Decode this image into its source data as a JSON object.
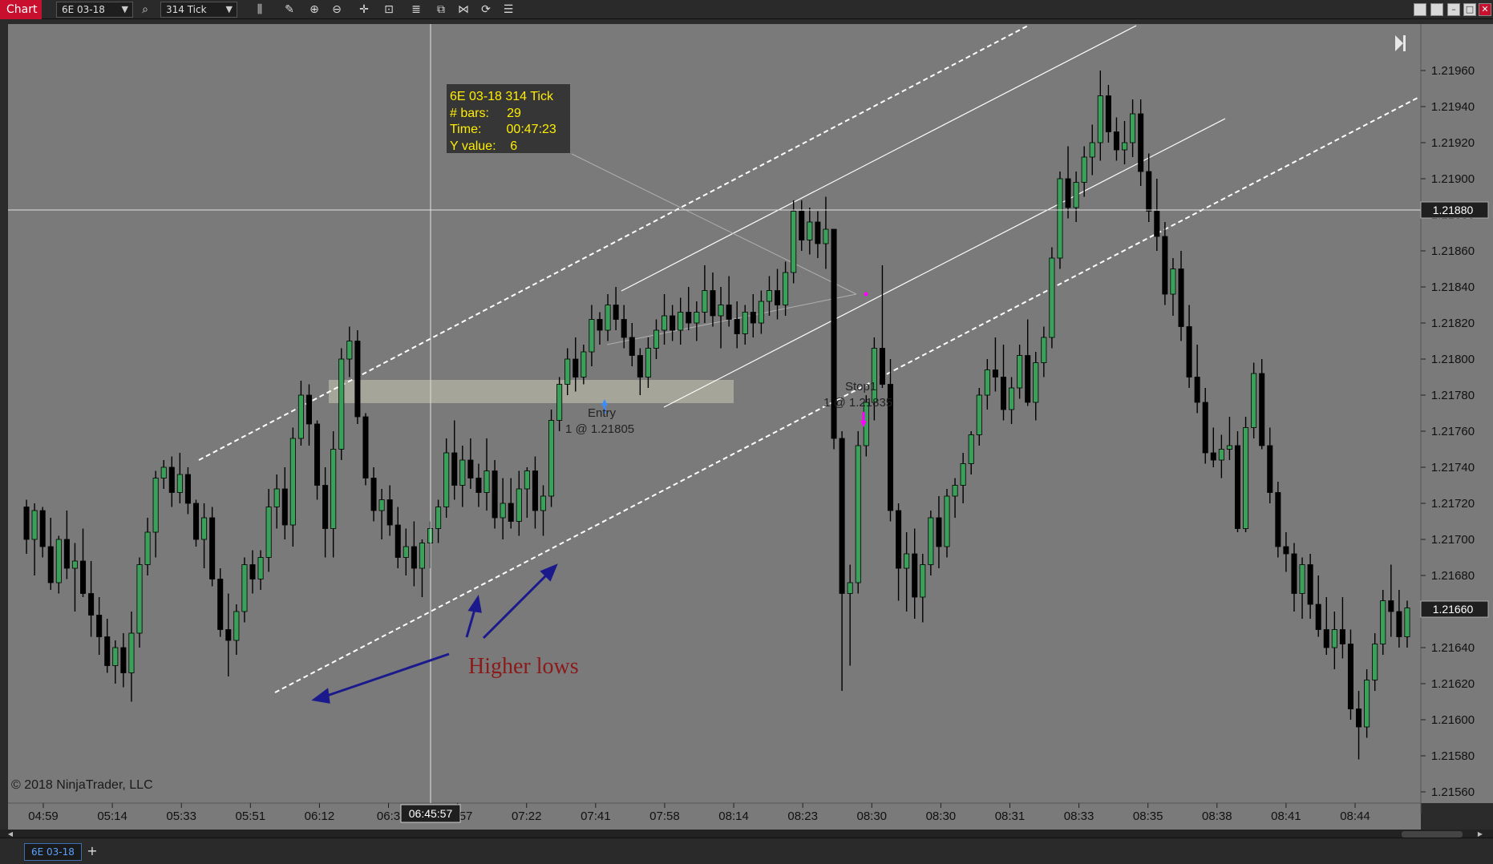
{
  "toolbar": {
    "chart_label": "Chart",
    "instrument": "6E 03-18",
    "interval": "314 Tick"
  },
  "tab": {
    "label": "6E 03-18",
    "add": "+"
  },
  "copyright": "© 2018 NinjaTrader, LLC",
  "data_box": {
    "line1": "6E 03-18 314 Tick",
    "line2": "# bars:     29",
    "line3": "Time:       00:47:23",
    "line4": "Y value:    6"
  },
  "annotation": {
    "text": "Higher lows"
  },
  "orders": {
    "entry_label": "Entry",
    "entry_price": "1 @ 1.21805",
    "stop_label": "Stop1",
    "stop_price": "1 @ 1.21835"
  },
  "crosshair": {
    "time_label": "06:45:57",
    "price_label": "1.21880"
  },
  "last_price_label": "1.21660",
  "colors": {
    "background": "#7a7a7a",
    "bull": "#3aa05a",
    "bear": "#000000",
    "annotation_text": "#8b1a1a",
    "arrows": "#1a1a8c",
    "data_box_text": "#ffee00",
    "zone": "#c8c8b4"
  },
  "chart_data": {
    "type": "candlestick",
    "price_axis_labels": [
      "1.21960",
      "1.21940",
      "1.21920",
      "1.21900",
      "1.21880",
      "1.21860",
      "1.21840",
      "1.21820",
      "1.21800",
      "1.21780",
      "1.21760",
      "1.21740",
      "1.21720",
      "1.21700",
      "1.21680",
      "1.21660",
      "1.21640",
      "1.21620",
      "1.21600",
      "1.21580",
      "1.21560"
    ],
    "ylim": [
      1.2156,
      1.2196
    ],
    "time_axis_labels": [
      "04:59",
      "05:14",
      "05:33",
      "05:51",
      "06:12",
      "06:3",
      "06:57",
      "07:22",
      "07:41",
      "07:58",
      "08:14",
      "08:23",
      "08:30",
      "08:30",
      "08:31",
      "08:33",
      "08:35",
      "08:38",
      "08:41",
      "08:44"
    ],
    "candles": [
      [
        1.21718,
        1.21722,
        1.21692,
        1.217
      ],
      [
        1.217,
        1.2172,
        1.2168,
        1.21716
      ],
      [
        1.21716,
        1.21718,
        1.2169,
        1.21696
      ],
      [
        1.21696,
        1.21712,
        1.21672,
        1.21676
      ],
      [
        1.21676,
        1.21702,
        1.2167,
        1.217
      ],
      [
        1.217,
        1.21716,
        1.21678,
        1.21684
      ],
      [
        1.21684,
        1.21698,
        1.2166,
        1.21688
      ],
      [
        1.21688,
        1.21706,
        1.21668,
        1.2167
      ],
      [
        1.2167,
        1.21688,
        1.21646,
        1.21658
      ],
      [
        1.21658,
        1.21668,
        1.21636,
        1.21646
      ],
      [
        1.21646,
        1.21656,
        1.21626,
        1.2163
      ],
      [
        1.2163,
        1.21644,
        1.2162,
        1.2164
      ],
      [
        1.2164,
        1.21648,
        1.21618,
        1.21626
      ],
      [
        1.21626,
        1.2166,
        1.2161,
        1.21648
      ],
      [
        1.21648,
        1.2169,
        1.2164,
        1.21686
      ],
      [
        1.21686,
        1.21712,
        1.2168,
        1.21704
      ],
      [
        1.21704,
        1.21738,
        1.2169,
        1.21734
      ],
      [
        1.21734,
        1.21744,
        1.21728,
        1.2174
      ],
      [
        1.2174,
        1.21746,
        1.21718,
        1.21726
      ],
      [
        1.21726,
        1.21748,
        1.2172,
        1.21736
      ],
      [
        1.21736,
        1.2174,
        1.21714,
        1.2172
      ],
      [
        1.2172,
        1.21722,
        1.21696,
        1.217
      ],
      [
        1.217,
        1.2172,
        1.21684,
        1.21712
      ],
      [
        1.21712,
        1.21718,
        1.21674,
        1.21678
      ],
      [
        1.21678,
        1.21684,
        1.21646,
        1.2165
      ],
      [
        1.2165,
        1.2167,
        1.21624,
        1.21644
      ],
      [
        1.21644,
        1.21664,
        1.21636,
        1.2166
      ],
      [
        1.2166,
        1.2169,
        1.21654,
        1.21686
      ],
      [
        1.21686,
        1.21694,
        1.2167,
        1.21678
      ],
      [
        1.21678,
        1.21694,
        1.21672,
        1.2169
      ],
      [
        1.2169,
        1.21728,
        1.21682,
        1.21718
      ],
      [
        1.21718,
        1.21736,
        1.21706,
        1.21728
      ],
      [
        1.21728,
        1.2174,
        1.217,
        1.21708
      ],
      [
        1.21708,
        1.21762,
        1.21696,
        1.21756
      ],
      [
        1.21756,
        1.21788,
        1.21752,
        1.2178
      ],
      [
        1.2178,
        1.21786,
        1.21752,
        1.21764
      ],
      [
        1.21764,
        1.21766,
        1.21722,
        1.2173
      ],
      [
        1.2173,
        1.2174,
        1.2169,
        1.21706
      ],
      [
        1.21706,
        1.2176,
        1.2169,
        1.2175
      ],
      [
        1.2175,
        1.21806,
        1.21744,
        1.218
      ],
      [
        1.218,
        1.21818,
        1.2179,
        1.2181
      ],
      [
        1.2181,
        1.21816,
        1.21764,
        1.21768
      ],
      [
        1.21768,
        1.2177,
        1.2173,
        1.21734
      ],
      [
        1.21734,
        1.2174,
        1.2171,
        1.21716
      ],
      [
        1.21716,
        1.21728,
        1.217,
        1.21722
      ],
      [
        1.21722,
        1.2173,
        1.21702,
        1.21708
      ],
      [
        1.21708,
        1.21718,
        1.21684,
        1.2169
      ],
      [
        1.2169,
        1.21706,
        1.2168,
        1.21696
      ],
      [
        1.21696,
        1.2171,
        1.21674,
        1.21684
      ],
      [
        1.21684,
        1.217,
        1.21668,
        1.21698
      ],
      [
        1.21698,
        1.2171,
        1.21684,
        1.21706
      ],
      [
        1.21706,
        1.21722,
        1.21698,
        1.21718
      ],
      [
        1.21718,
        1.21756,
        1.21712,
        1.21748
      ],
      [
        1.21748,
        1.21766,
        1.21722,
        1.2173
      ],
      [
        1.2173,
        1.21752,
        1.21718,
        1.21744
      ],
      [
        1.21744,
        1.21756,
        1.21728,
        1.21734
      ],
      [
        1.21734,
        1.21742,
        1.21718,
        1.21726
      ],
      [
        1.21726,
        1.21756,
        1.21716,
        1.21738
      ],
      [
        1.21738,
        1.21744,
        1.21706,
        1.21712
      ],
      [
        1.21712,
        1.21734,
        1.217,
        1.2172
      ],
      [
        1.2172,
        1.21734,
        1.21706,
        1.2171
      ],
      [
        1.2171,
        1.21738,
        1.21702,
        1.21728
      ],
      [
        1.21728,
        1.2174,
        1.21712,
        1.21738
      ],
      [
        1.21738,
        1.21746,
        1.21706,
        1.21716
      ],
      [
        1.21716,
        1.2173,
        1.21702,
        1.21724
      ],
      [
        1.21724,
        1.21772,
        1.21718,
        1.21766
      ],
      [
        1.21766,
        1.2179,
        1.2176,
        1.21786
      ],
      [
        1.21786,
        1.21806,
        1.2178,
        1.218
      ],
      [
        1.218,
        1.21812,
        1.21782,
        1.2179
      ],
      [
        1.2179,
        1.21808,
        1.21786,
        1.21804
      ],
      [
        1.21804,
        1.2183,
        1.21796,
        1.21822
      ],
      [
        1.21822,
        1.21826,
        1.21808,
        1.21816
      ],
      [
        1.21816,
        1.21836,
        1.2181,
        1.2183
      ],
      [
        1.2183,
        1.2184,
        1.21816,
        1.21822
      ],
      [
        1.21822,
        1.2183,
        1.21806,
        1.21812
      ],
      [
        1.21812,
        1.2182,
        1.21796,
        1.21802
      ],
      [
        1.21802,
        1.21806,
        1.2178,
        1.2179
      ],
      [
        1.2179,
        1.21812,
        1.21784,
        1.21806
      ],
      [
        1.21806,
        1.21822,
        1.218,
        1.21816
      ],
      [
        1.21816,
        1.21836,
        1.21808,
        1.21824
      ],
      [
        1.21824,
        1.2183,
        1.2181,
        1.21816
      ],
      [
        1.21816,
        1.21834,
        1.21808,
        1.21826
      ],
      [
        1.21826,
        1.2184,
        1.21816,
        1.2182
      ],
      [
        1.2182,
        1.21832,
        1.2181,
        1.21826
      ],
      [
        1.21826,
        1.21852,
        1.2182,
        1.21838
      ],
      [
        1.21838,
        1.21848,
        1.21818,
        1.21824
      ],
      [
        1.21824,
        1.2184,
        1.21806,
        1.2183
      ],
      [
        1.2183,
        1.21846,
        1.21818,
        1.21822
      ],
      [
        1.21822,
        1.21832,
        1.21806,
        1.21814
      ],
      [
        1.21814,
        1.2183,
        1.21808,
        1.21826
      ],
      [
        1.21826,
        1.21836,
        1.21812,
        1.2182
      ],
      [
        1.2182,
        1.21838,
        1.21814,
        1.21832
      ],
      [
        1.21832,
        1.21846,
        1.21824,
        1.21838
      ],
      [
        1.21838,
        1.2185,
        1.21822,
        1.2183
      ],
      [
        1.2183,
        1.21854,
        1.21824,
        1.21848
      ],
      [
        1.21848,
        1.21888,
        1.21842,
        1.21882
      ],
      [
        1.21882,
        1.21888,
        1.2186,
        1.21866
      ],
      [
        1.21866,
        1.21884,
        1.21858,
        1.21876
      ],
      [
        1.21876,
        1.21882,
        1.21856,
        1.21864
      ],
      [
        1.21864,
        1.2189,
        1.2185,
        1.21872
      ],
      [
        1.21872,
        1.21872,
        1.2175,
        1.21756
      ],
      [
        1.21756,
        1.2176,
        1.21616,
        1.2167
      ],
      [
        1.2167,
        1.21686,
        1.2163,
        1.21676
      ],
      [
        1.21676,
        1.2176,
        1.2167,
        1.21752
      ],
      [
        1.21752,
        1.2178,
        1.21746,
        1.21776
      ],
      [
        1.21776,
        1.21812,
        1.21766,
        1.21806
      ],
      [
        1.21806,
        1.21852,
        1.21784,
        1.21786
      ],
      [
        1.21786,
        1.218,
        1.2171,
        1.21716
      ],
      [
        1.21716,
        1.2172,
        1.21666,
        1.21684
      ],
      [
        1.21684,
        1.21704,
        1.2166,
        1.21692
      ],
      [
        1.21692,
        1.21706,
        1.21656,
        1.21668
      ],
      [
        1.21668,
        1.21692,
        1.21654,
        1.21686
      ],
      [
        1.21686,
        1.21716,
        1.2168,
        1.21712
      ],
      [
        1.21712,
        1.21724,
        1.21684,
        1.21696
      ],
      [
        1.21696,
        1.21728,
        1.2169,
        1.21724
      ],
      [
        1.21724,
        1.21734,
        1.21712,
        1.2173
      ],
      [
        1.2173,
        1.21748,
        1.2172,
        1.21742
      ],
      [
        1.21742,
        1.2176,
        1.21736,
        1.21758
      ],
      [
        1.21758,
        1.21784,
        1.21752,
        1.2178
      ],
      [
        1.2178,
        1.218,
        1.21772,
        1.21794
      ],
      [
        1.21794,
        1.21812,
        1.21782,
        1.2179
      ],
      [
        1.2179,
        1.21808,
        1.21766,
        1.21772
      ],
      [
        1.21772,
        1.2179,
        1.21764,
        1.21784
      ],
      [
        1.21784,
        1.21808,
        1.21778,
        1.21802
      ],
      [
        1.21802,
        1.21822,
        1.21774,
        1.21776
      ],
      [
        1.21776,
        1.21804,
        1.21766,
        1.21798
      ],
      [
        1.21798,
        1.21818,
        1.2179,
        1.21812
      ],
      [
        1.21812,
        1.21862,
        1.21806,
        1.21856
      ],
      [
        1.21856,
        1.21904,
        1.2185,
        1.219
      ],
      [
        1.219,
        1.21918,
        1.21878,
        1.21884
      ],
      [
        1.21884,
        1.21904,
        1.21876,
        1.21898
      ],
      [
        1.21898,
        1.21918,
        1.2189,
        1.21912
      ],
      [
        1.21912,
        1.2193,
        1.21902,
        1.2192
      ],
      [
        1.2192,
        1.2196,
        1.2191,
        1.21946
      ],
      [
        1.21946,
        1.21952,
        1.2192,
        1.21926
      ],
      [
        1.21926,
        1.21934,
        1.2191,
        1.21916
      ],
      [
        1.21916,
        1.21932,
        1.21908,
        1.2192
      ],
      [
        1.2192,
        1.21944,
        1.21912,
        1.21936
      ],
      [
        1.21936,
        1.21944,
        1.21896,
        1.21904
      ],
      [
        1.21904,
        1.21914,
        1.21876,
        1.21882
      ],
      [
        1.21882,
        1.219,
        1.2186,
        1.21868
      ],
      [
        1.21868,
        1.21876,
        1.2183,
        1.21836
      ],
      [
        1.21836,
        1.21856,
        1.21824,
        1.2185
      ],
      [
        1.2185,
        1.2186,
        1.2181,
        1.21818
      ],
      [
        1.21818,
        1.2183,
        1.21784,
        1.2179
      ],
      [
        1.2179,
        1.21808,
        1.2177,
        1.21776
      ],
      [
        1.21776,
        1.21784,
        1.21742,
        1.21748
      ],
      [
        1.21748,
        1.21762,
        1.2174,
        1.21744
      ],
      [
        1.21744,
        1.21758,
        1.21734,
        1.2175
      ],
      [
        1.2175,
        1.21768,
        1.21744,
        1.21752
      ],
      [
        1.21752,
        1.2176,
        1.21704,
        1.21706
      ],
      [
        1.21706,
        1.21768,
        1.21704,
        1.21762
      ],
      [
        1.21762,
        1.21798,
        1.21756,
        1.21792
      ],
      [
        1.21792,
        1.218,
        1.2175,
        1.21752
      ],
      [
        1.21752,
        1.21762,
        1.2172,
        1.21726
      ],
      [
        1.21726,
        1.21732,
        1.2169,
        1.21696
      ],
      [
        1.21696,
        1.21704,
        1.21682,
        1.21692
      ],
      [
        1.21692,
        1.21698,
        1.2166,
        1.2167
      ],
      [
        1.2167,
        1.2169,
        1.21656,
        1.21686
      ],
      [
        1.21686,
        1.21692,
        1.21656,
        1.21664
      ],
      [
        1.21664,
        1.2168,
        1.21646,
        1.2165
      ],
      [
        1.2165,
        1.21668,
        1.21636,
        1.2164
      ],
      [
        1.2164,
        1.2166,
        1.21628,
        1.2165
      ],
      [
        1.2165,
        1.21668,
        1.21634,
        1.21642
      ],
      [
        1.21642,
        1.2165,
        1.216,
        1.21606
      ],
      [
        1.21606,
        1.21616,
        1.21578,
        1.21596
      ],
      [
        1.21596,
        1.21628,
        1.2159,
        1.21622
      ],
      [
        1.21622,
        1.21648,
        1.21616,
        1.21642
      ],
      [
        1.21642,
        1.21672,
        1.21636,
        1.21666
      ],
      [
        1.21666,
        1.21686,
        1.21646,
        1.2166
      ],
      [
        1.2166,
        1.21672,
        1.2164,
        1.21646
      ],
      [
        1.21646,
        1.21666,
        1.2164,
        1.21662
      ]
    ]
  }
}
